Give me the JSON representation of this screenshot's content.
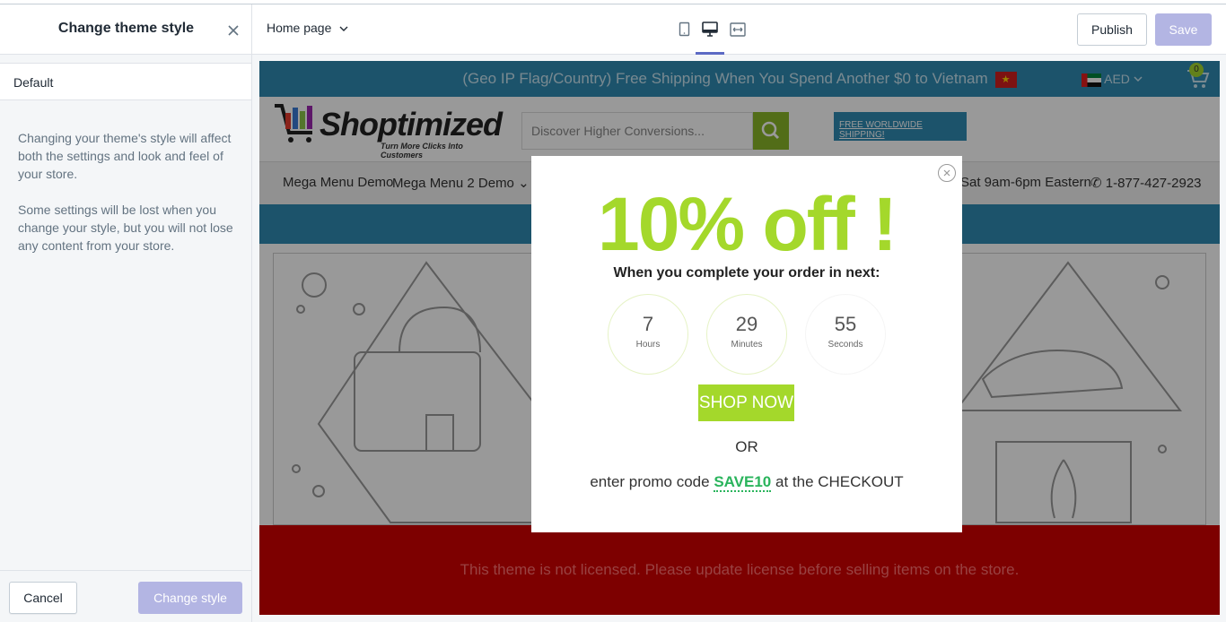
{
  "sidebar": {
    "title": "Change theme style",
    "selected_style": "Default",
    "description_1": "Changing your theme's style will affect both the settings and look and feel of your store.",
    "description_2": "Some settings will be lost when you change your style, but you will not lose any content from your store.",
    "cancel_label": "Cancel",
    "change_label": "Change style"
  },
  "topbar": {
    "page_selector": "Home page",
    "publish_label": "Publish",
    "save_label": "Save",
    "accent_color": "#5c6ac4"
  },
  "store": {
    "announcement": "(Geo IP Flag/Country) Free Shipping When You Spend Another $0 to Vietnam",
    "currency": "AED",
    "cart_count": "0",
    "logo_text": "Shoptimized",
    "logo_tagline": "Turn More Clicks Into Customers",
    "search_placeholder": "Discover Higher Conversions...",
    "free_shipping": "FREE WORLDWIDE SHIPPING!",
    "nav": [
      "Mega Menu Demo",
      "Mega Menu 2 Demo"
    ],
    "hours": "-Sat 9am-6pm Eastern",
    "phone": "1-877-427-2923",
    "license_notice": "This theme is not licensed. Please update license before selling items on the store."
  },
  "popup": {
    "title": "10% off !",
    "subtitle": "When you complete your order in next:",
    "hours_value": "7",
    "hours_label": "Hours",
    "minutes_value": "29",
    "minutes_label": "Minutes",
    "seconds_value": "55",
    "seconds_label": "Seconds",
    "shop_now_label": "SHOP NOW",
    "or_text": "OR",
    "promo_prefix": "enter promo code",
    "promo_code": "SAVE10",
    "promo_suffix": "at the CHECKOUT",
    "accent_color": "#a4d82b"
  }
}
